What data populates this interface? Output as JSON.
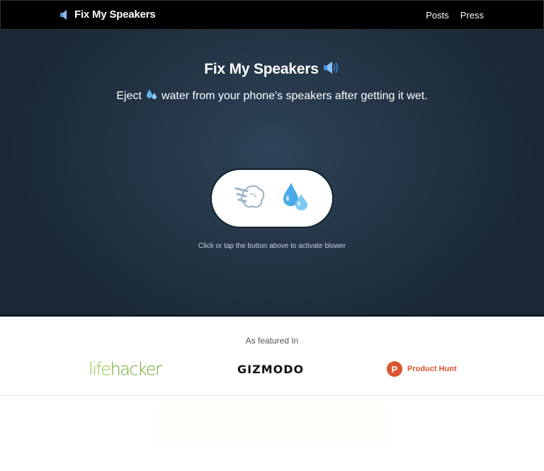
{
  "navbar": {
    "brand": "Fix My Speakers",
    "brand_icon": "speaker-icon",
    "links": [
      "Posts",
      "Press"
    ]
  },
  "hero": {
    "title": "Fix My Speakers",
    "title_icon": "speaker-loud-icon",
    "subtitle_before": "Eject",
    "subtitle_icon": "water-droplets-icon",
    "subtitle_after": "water from your phone's speakers after getting it wet.",
    "button_icons": [
      "dashing-away-icon",
      "water-droplets-icon"
    ],
    "hint": "Click or tap the button above to activate blower"
  },
  "featured": {
    "label": "As featured In",
    "logos": {
      "lifehacker_a": "life",
      "lifehacker_b": "hacker",
      "gizmodo": "GIZMODO",
      "producthunt_letter": "P",
      "producthunt": "Product Hunt"
    }
  },
  "colors": {
    "navbar_bg": "#000000",
    "hero_bg": "#243648",
    "lifehacker_green": "#8dc63f",
    "producthunt_orange": "#da552f"
  }
}
